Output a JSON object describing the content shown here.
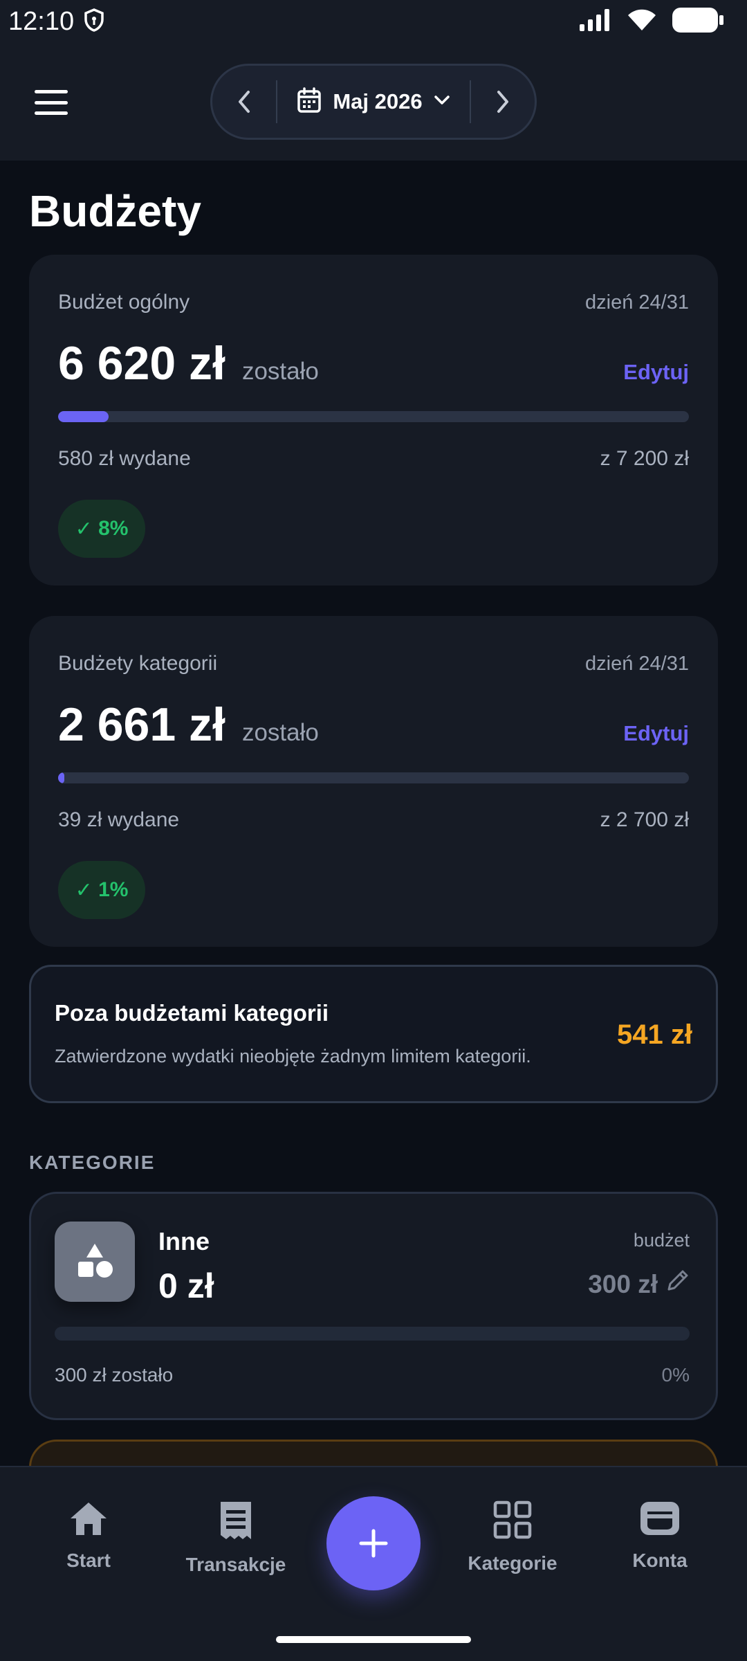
{
  "status_bar": {
    "time": "12:10"
  },
  "header": {
    "month_label": "Maj 2026"
  },
  "page_title": "Budżety",
  "overall_budget": {
    "title": "Budżet ogólny",
    "day": "dzień 24/31",
    "amount": "6 620 zł",
    "suffix": "zostało",
    "edit_label": "Edytuj",
    "spent": "580 zł wydane",
    "total": "z 7 200 zł",
    "percent_label": "8%",
    "progress": 0.08
  },
  "category_budgets": {
    "title": "Budżety kategorii",
    "day": "dzień 24/31",
    "amount": "2 661 zł",
    "suffix": "zostało",
    "edit_label": "Edytuj",
    "spent": "39 zł wydane",
    "total": "z 2 700 zł",
    "percent_label": "1%",
    "progress": 0.01
  },
  "outside": {
    "title": "Poza budżetami kategorii",
    "description": "Zatwierdzone wydatki nieobjęte żadnym limitem kategorii.",
    "amount": "541 zł"
  },
  "section_label": "KATEGORIE",
  "category": {
    "icon": "shapes-icon",
    "name": "Inne",
    "spent": "0 zł",
    "budget_label": "budżet",
    "budget_value": "300 zł",
    "left": "300 zł zostało",
    "percent": "0%",
    "progress": 0
  },
  "bottom_nav": {
    "items": [
      {
        "label": "Start",
        "icon": "home-icon"
      },
      {
        "label": "Transakcje",
        "icon": "receipt-icon"
      },
      {
        "label": "Kategorie",
        "icon": "grid-icon"
      },
      {
        "label": "Konta",
        "icon": "wallet-icon"
      }
    ]
  },
  "colors": {
    "accent": "#6c63f5",
    "success": "#24c26c",
    "warning": "#f5a623",
    "background": "#0b0f17",
    "surface": "#161b25"
  }
}
